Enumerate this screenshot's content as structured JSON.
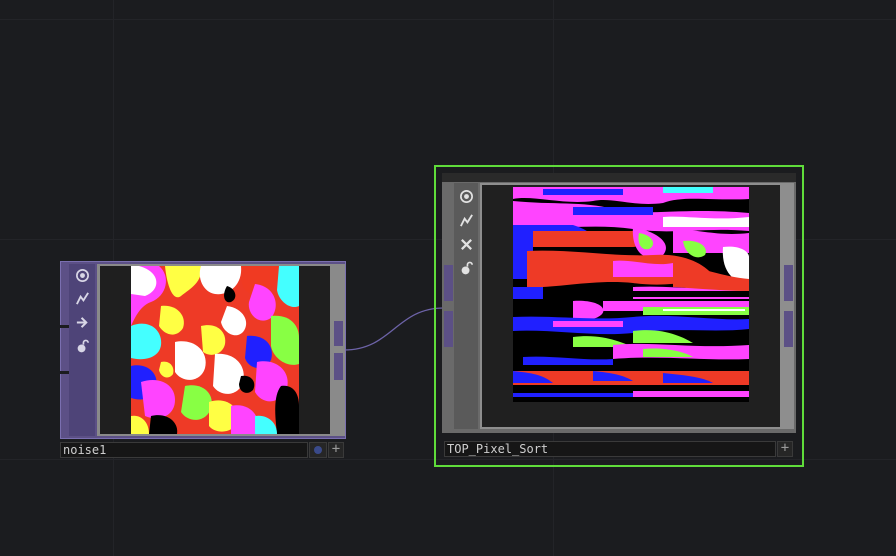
{
  "canvas": {
    "background": "#1b1c1f",
    "grid_color": "#232428"
  },
  "nodes": {
    "noise": {
      "label": "noise1",
      "type_color": "#5c5086",
      "toolbar": [
        {
          "icon": "viewer-toggle-icon"
        },
        {
          "icon": "cook-toggle-icon"
        },
        {
          "icon": "bypass-arrow-icon"
        },
        {
          "icon": "lock-icon"
        }
      ],
      "add_label": "+"
    },
    "pixel_sort": {
      "label": "TOP_Pixel_Sort",
      "selected": true,
      "selection_color": "#5fdc3a",
      "type_color": "#6a6a6a",
      "toolbar": [
        {
          "icon": "viewer-toggle-icon"
        },
        {
          "icon": "cook-toggle-icon"
        },
        {
          "icon": "close-x-icon"
        },
        {
          "icon": "lock-icon"
        }
      ],
      "add_label": "+"
    }
  },
  "wire": {
    "from": "noise1",
    "to": "TOP_Pixel_Sort",
    "color": "#6d63a8"
  }
}
